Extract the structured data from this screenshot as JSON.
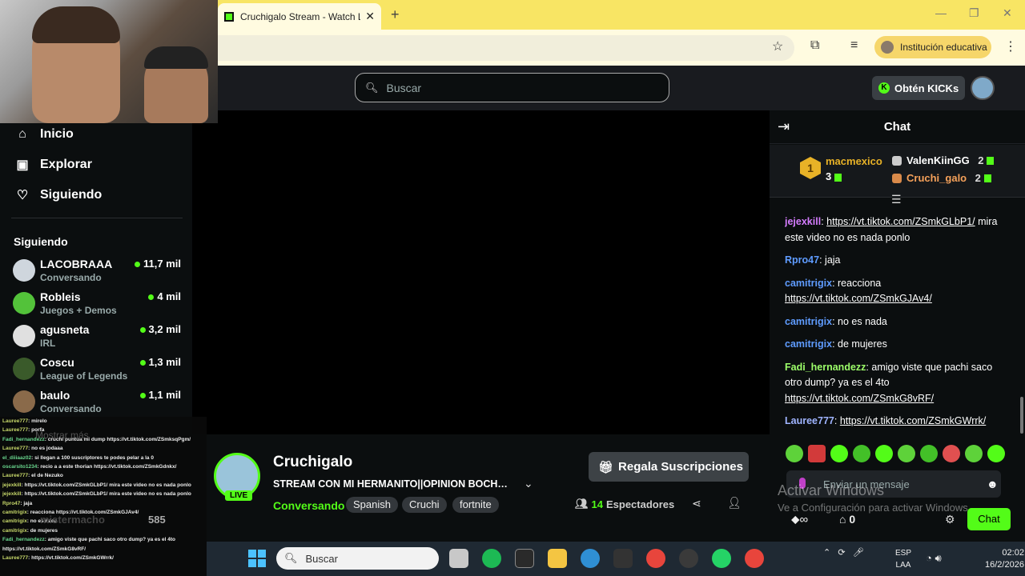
{
  "browser": {
    "tab_title": "Cruchigalo Stream - Watch Live",
    "profile_label": "Institución educativa",
    "colors": {
      "tabbar": "#f8e564",
      "brand": "#53fc18"
    }
  },
  "header": {
    "search_placeholder": "Buscar",
    "kicks_label": "Obtén KICKs"
  },
  "sidebar": {
    "nav": [
      {
        "label": "Inicio",
        "icon": "home-icon"
      },
      {
        "label": "Explorar",
        "icon": "explore-icon"
      },
      {
        "label": "Siguiendo",
        "icon": "heart-icon"
      }
    ],
    "following_title": "Siguiendo",
    "channels": [
      {
        "name": "LACOBRAAA",
        "category": "Conversando",
        "viewers": "11,7 mil",
        "color": "#cfd6dd"
      },
      {
        "name": "Robleis",
        "category": "Juegos + Demos",
        "viewers": "4 mil",
        "color": "#53c23a"
      },
      {
        "name": "agusneta",
        "category": "IRL",
        "viewers": "3,2 mil",
        "color": "#e0e0e0"
      },
      {
        "name": "Coscu",
        "category": "League of Legends",
        "viewers": "1,3 mil",
        "color": "#3a5a2a"
      },
      {
        "name": "baulo",
        "category": "Conversando",
        "viewers": "1,1 mil",
        "color": "#8a6a4a"
      }
    ],
    "ghost_more": "Mostrar más",
    "ghost_channel": "mistermacho",
    "ghost_viewers": "585"
  },
  "overlay_chat": [
    {
      "user": "Lauree777",
      "text": ": mirelo"
    },
    {
      "user": "Lauree777",
      "text": ": porfa"
    },
    {
      "user": "Fadi_hernandezz",
      "text": ": cruchi puntua mi dump https://vt.tiktok.com/ZSmksqPgm/"
    },
    {
      "user": "Lauree777",
      "text": ": no es jodaaa"
    },
    {
      "user": "el_diiiaaz02",
      "text": ": si llegan a 100 suscriptores te podes pelar a la 0"
    },
    {
      "user": "oscarsito1234",
      "text": ": recio a a este thorian https://vt.tiktok.com/ZSmkGdnkx/"
    },
    {
      "user": "Lauree777",
      "text": ": el de Nezuko"
    },
    {
      "user": "jejexkill",
      "text": ": https://vt.tiktok.com/ZSmkGLbP1/ mira este video no es nada ponlo"
    },
    {
      "user": "jejexkill",
      "text": ": https://vt.tiktok.com/ZSmkGLbP1/ mira este video no es nada ponlo"
    },
    {
      "user": "Rpro47",
      "text": ": jaja"
    },
    {
      "user": "camitrigix",
      "text": ": reacciona https://vt.tiktok.com/ZSmkGJAv4/"
    },
    {
      "user": "camitrigix",
      "text": ": no es nada"
    },
    {
      "user": "camitrigix",
      "text": ": de mujeres"
    },
    {
      "user": "Fadi_hernandezz",
      "text": ": amigo viste que pachi saco otro dump? ya es el 4to"
    },
    {
      "user": "",
      "text": "https://vt.tiktok.com/ZSmkG8vRF/"
    },
    {
      "user": "Lauree777",
      "text": ": https://vt.tiktok.com/ZSmkGWrrk/"
    }
  ],
  "stream": {
    "name": "Cruchigalo",
    "live": "LIVE",
    "title": "STREAM CON MI HERMANITO||OPINION BOCHORNO",
    "category": "Conversando",
    "tags": [
      "Spanish",
      "Cruchi",
      "fortnite"
    ],
    "gift_label": "Regala Suscripciones",
    "viewer_count": "14",
    "viewer_label": "Espectadores"
  },
  "chat": {
    "title": "Chat",
    "leaderboard": {
      "first": {
        "rank": "1",
        "name": "macmexico",
        "count": "3"
      },
      "second": {
        "name": "ValenKiinGG",
        "count": "2"
      },
      "third": {
        "name": "Cruchi_galo",
        "count": "2"
      }
    },
    "messages": [
      {
        "user": "jejexkill",
        "color": "#d57dff",
        "link": "https://vt.tiktok.com/ZSmkGLbP1/",
        "text": " mira este video no es nada ponlo",
        "link_first": true
      },
      {
        "user": "Rpro47",
        "color": "#5f9cff",
        "text": " jaja"
      },
      {
        "user": "camitrigix",
        "color": "#5f9cff",
        "text": " reacciona ",
        "link": "https://vt.tiktok.com/ZSmkGJAv4/"
      },
      {
        "user": "camitrigix",
        "color": "#5f9cff",
        "text": " no es nada"
      },
      {
        "user": "camitrigix",
        "color": "#5f9cff",
        "text": " de mujeres"
      },
      {
        "user": "Fadi_hernandezz",
        "color": "#9dff6a",
        "text": " amigo viste que pachi saco otro dump? ya es el 4to ",
        "link": "https://vt.tiktok.com/ZSmkG8vRF/"
      },
      {
        "user": "Lauree777",
        "color": "#9fb4ff",
        "text": " ",
        "link": "https://vt.tiktok.com/ZSmkGWrrk/"
      }
    ],
    "input_placeholder": "Enviar un mensaje",
    "points": "0",
    "send_label": "Chat",
    "watermark_line1": "Activar Windows",
    "watermark_line2": "Ve a Configuración para activar Windows."
  },
  "taskbar": {
    "search_placeholder": "Buscar",
    "lang_top": "ESP",
    "lang_bottom": "LAA",
    "time": "02:02",
    "date": "16/2/2026"
  }
}
